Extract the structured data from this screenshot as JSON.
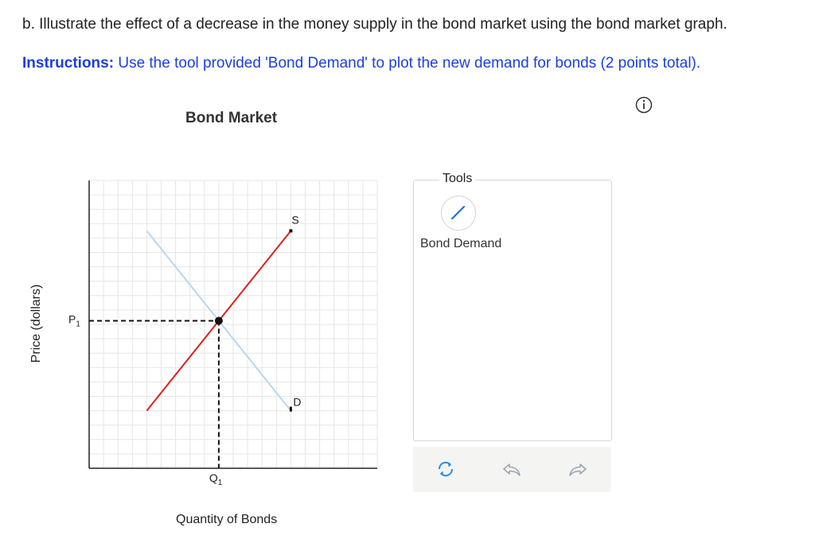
{
  "question": {
    "text": "b. Illustrate the effect of a decrease in the money supply in the bond market using the bond market graph."
  },
  "instructions": {
    "label": "Instructions:",
    "text": " Use the tool provided 'Bond Demand' to plot the new demand for bonds (2 points total)."
  },
  "icons": {
    "info": "info-icon",
    "line_tool": "line-tool-icon",
    "reset": "reset-icon",
    "undo": "undo-icon",
    "redo": "redo-icon"
  },
  "chart_data": {
    "type": "line",
    "title": "Bond Market",
    "xlabel": "Quantity of Bonds",
    "ylabel": "Price (dollars)",
    "xlim": [
      0,
      20
    ],
    "ylim": [
      0,
      20
    ],
    "grid": true,
    "series": [
      {
        "name": "S",
        "color": "#e0201e",
        "x": [
          4,
          14
        ],
        "y": [
          4,
          16.5
        ]
      },
      {
        "name": "D",
        "color": "#b9d6f2",
        "x": [
          4,
          14
        ],
        "y": [
          16.5,
          4
        ]
      }
    ],
    "equilibrium": {
      "x": 9,
      "y": 10.25
    },
    "tick_labels": {
      "x": "Q",
      "x_sub": "1",
      "y": "P",
      "y_sub": "1"
    },
    "colors": {
      "grid": "#e6e6e6",
      "axis": "#222222",
      "point": "#111111"
    }
  },
  "tools": {
    "legend": "Tools",
    "items": [
      {
        "label": "Bond Demand"
      }
    ]
  }
}
